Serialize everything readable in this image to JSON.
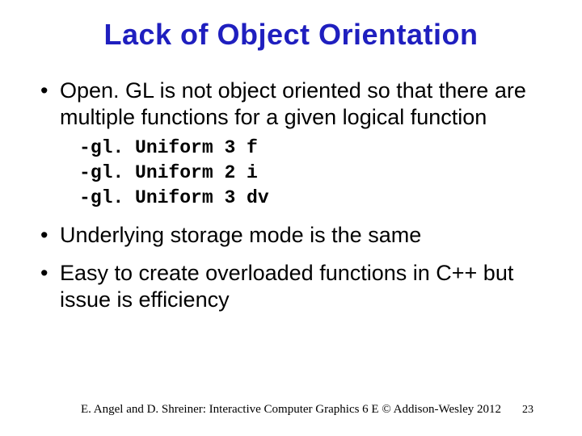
{
  "title": "Lack of Object Orientation",
  "bullets": {
    "b1": "Open. GL is not object oriented so that there are multiple functions for a given logical function",
    "code": {
      "c1": "gl. Uniform 3 f",
      "c2": "gl. Uniform 2 i",
      "c3": "gl. Uniform 3 dv"
    },
    "b2": "Underlying storage mode is the same",
    "b3": "Easy to create overloaded functions in C++ but issue is efficiency"
  },
  "footer": "E. Angel and D. Shreiner: Interactive Computer Graphics 6 E © Addison-Wesley 2012",
  "pageNumber": "23"
}
